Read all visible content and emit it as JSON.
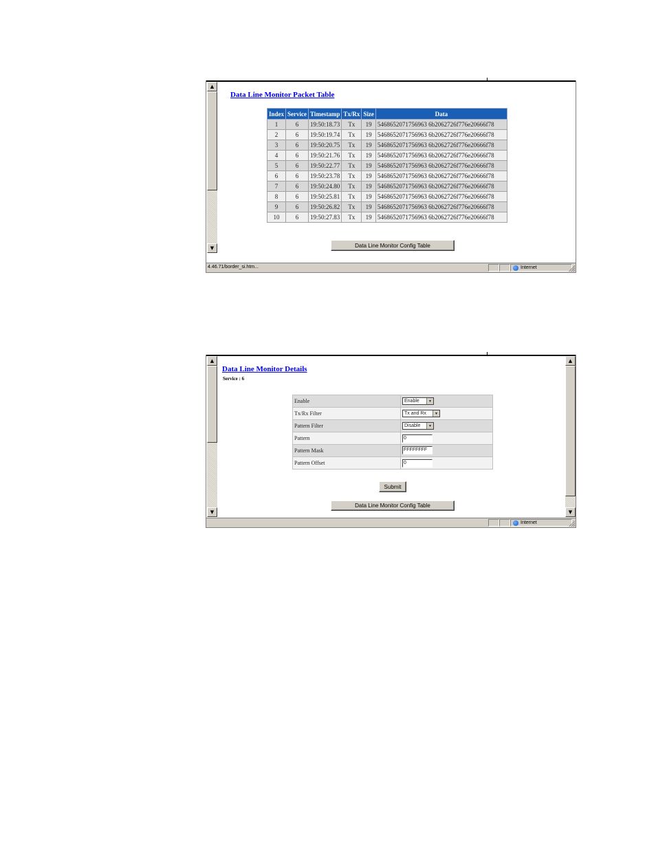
{
  "packet_window": {
    "title": "Data Line Monitor Packet Table",
    "columns": [
      "Index",
      "Service",
      "Timestamp",
      "Tx/Rx",
      "Size",
      "Data"
    ],
    "rows": [
      [
        "1",
        "6",
        "19:50:18.73",
        "Tx",
        "19",
        "5468652071756963 6b2062726f776e20666f78"
      ],
      [
        "2",
        "6",
        "19:50:19.74",
        "Tx",
        "19",
        "5468652071756963 6b2062726f776e20666f78"
      ],
      [
        "3",
        "6",
        "19:50:20.75",
        "Tx",
        "19",
        "5468652071756963 6b2062726f776e20666f78"
      ],
      [
        "4",
        "6",
        "19:50:21.76",
        "Tx",
        "19",
        "5468652071756963 6b2062726f776e20666f78"
      ],
      [
        "5",
        "6",
        "19:50:22.77",
        "Tx",
        "19",
        "5468652071756963 6b2062726f776e20666f78"
      ],
      [
        "6",
        "6",
        "19:50:23.78",
        "Tx",
        "19",
        "5468652071756963 6b2062726f776e20666f78"
      ],
      [
        "7",
        "6",
        "19:50:24.80",
        "Tx",
        "19",
        "5468652071756963 6b2062726f776e20666f78"
      ],
      [
        "8",
        "6",
        "19:50:25.81",
        "Tx",
        "19",
        "5468652071756963 6b2062726f776e20666f78"
      ],
      [
        "9",
        "6",
        "19:50:26.82",
        "Tx",
        "19",
        "5468652071756963 6b2062726f776e20666f78"
      ],
      [
        "10",
        "6",
        "19:50:27.83",
        "Tx",
        "19",
        "5468652071756963 6b2062726f776e20666f78"
      ]
    ],
    "config_button": "Data Line Monitor Config Table",
    "status_url": "4.46.71/border_si.htm...",
    "status_zone": "Internet"
  },
  "details_window": {
    "title": "Data Line Monitor Details",
    "service": "Service : 6",
    "fields": {
      "enable": {
        "label": "Enable",
        "value": "Enable"
      },
      "txrx": {
        "label": "Tx/Rx Filter",
        "value": "Tx and Rx"
      },
      "pattern_filter": {
        "label": "Pattern Filter",
        "value": "Disable"
      },
      "pattern": {
        "label": "Pattern",
        "value": "0"
      },
      "pattern_mask": {
        "label": "Pattern Mask",
        "value": "FFFFFFFF"
      },
      "pattern_offset": {
        "label": "Pattern Offset",
        "value": "0"
      }
    },
    "submit_button": "Submit",
    "config_button": "Data Line Monitor Config Table",
    "status_zone": "Internet"
  },
  "icons": {
    "scroll_up": "scroll-up-arrow-icon",
    "scroll_down": "scroll-down-arrow-icon",
    "zone": "globe-icon",
    "dropdown": "chevron-down-icon"
  }
}
